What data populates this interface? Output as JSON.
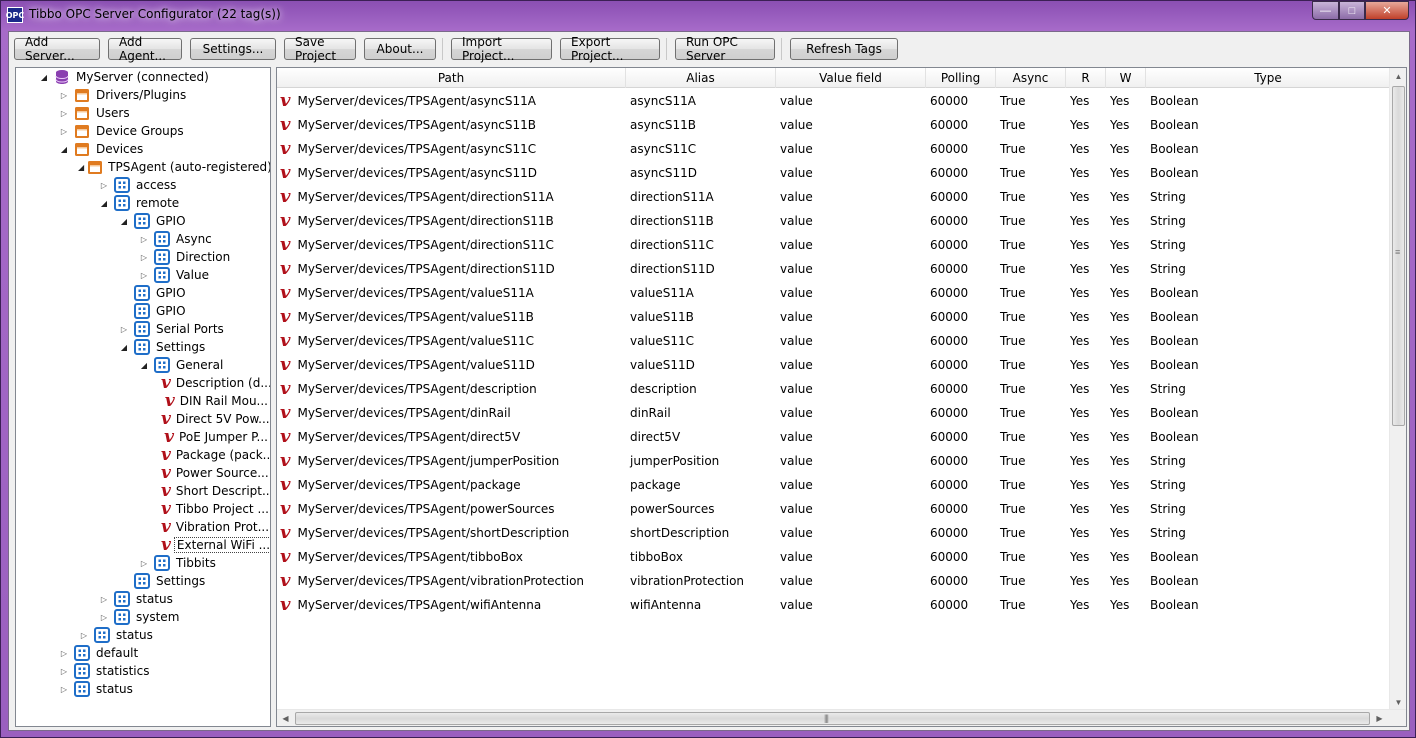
{
  "window": {
    "title": "Tibbo OPC Server Configurator (22 tag(s))",
    "icon_text": "OPC",
    "minimize_glyph": "—",
    "maximize_glyph": "□",
    "close_glyph": "✕"
  },
  "toolbar": {
    "buttons": [
      {
        "label": "Add Server..."
      },
      {
        "label": "Add Agent..."
      },
      {
        "label": "Settings..."
      },
      {
        "label": "Save Project"
      },
      {
        "label": "About..."
      },
      {
        "label": "Import Project..."
      },
      {
        "label": "Export Project..."
      },
      {
        "label": "Run OPC Server"
      },
      {
        "label": "Refresh Tags"
      }
    ]
  },
  "tree": {
    "items": [
      {
        "label": "MyServer (connected)",
        "level": 0,
        "icon": "database-icon",
        "expander": "open"
      },
      {
        "label": "Drivers/Plugins",
        "level": 1,
        "icon": "folder-icon",
        "expander": "closed"
      },
      {
        "label": "Users",
        "level": 1,
        "icon": "folder-icon",
        "expander": "closed"
      },
      {
        "label": "Device Groups",
        "level": 1,
        "icon": "folder-icon",
        "expander": "closed"
      },
      {
        "label": "Devices",
        "level": 1,
        "icon": "folder-icon",
        "expander": "open"
      },
      {
        "label": "TPSAgent (auto-registered)",
        "level": 2,
        "icon": "folder-icon",
        "expander": "open"
      },
      {
        "label": "access",
        "level": 3,
        "icon": "node-icon",
        "expander": "closed"
      },
      {
        "label": "remote",
        "level": 3,
        "icon": "node-icon",
        "expander": "open"
      },
      {
        "label": "GPIO",
        "level": 4,
        "icon": "node-icon",
        "expander": "open"
      },
      {
        "label": "Async",
        "level": 5,
        "icon": "node-icon",
        "expander": "closed"
      },
      {
        "label": "Direction",
        "level": 5,
        "icon": "node-icon",
        "expander": "closed"
      },
      {
        "label": "Value",
        "level": 5,
        "icon": "node-icon",
        "expander": "closed"
      },
      {
        "label": "GPIO",
        "level": 4,
        "icon": "node-icon",
        "expander": "none"
      },
      {
        "label": "GPIO",
        "level": 4,
        "icon": "node-icon",
        "expander": "none"
      },
      {
        "label": "Serial Ports",
        "level": 4,
        "icon": "node-icon",
        "expander": "closed"
      },
      {
        "label": "Settings",
        "level": 4,
        "icon": "node-icon",
        "expander": "open"
      },
      {
        "label": "General",
        "level": 5,
        "icon": "node-icon",
        "expander": "open"
      },
      {
        "label": "Description (d...",
        "level": 6,
        "icon": "variable-icon",
        "expander": "none"
      },
      {
        "label": "DIN Rail Mou...",
        "level": 6,
        "icon": "variable-icon",
        "expander": "none"
      },
      {
        "label": "Direct 5V Pow...",
        "level": 6,
        "icon": "variable-icon",
        "expander": "none"
      },
      {
        "label": "PoE Jumper P...",
        "level": 6,
        "icon": "variable-icon",
        "expander": "none"
      },
      {
        "label": "Package (pack...",
        "level": 6,
        "icon": "variable-icon",
        "expander": "none"
      },
      {
        "label": "Power Source...",
        "level": 6,
        "icon": "variable-icon",
        "expander": "none"
      },
      {
        "label": "Short Descript...",
        "level": 6,
        "icon": "variable-icon",
        "expander": "none"
      },
      {
        "label": "Tibbo Project ...",
        "level": 6,
        "icon": "variable-icon",
        "expander": "none"
      },
      {
        "label": "Vibration Prot...",
        "level": 6,
        "icon": "variable-icon",
        "expander": "none"
      },
      {
        "label": "External WiFi ...",
        "level": 6,
        "icon": "variable-icon",
        "expander": "none",
        "selected": true
      },
      {
        "label": "Tibbits",
        "level": 5,
        "icon": "node-icon",
        "expander": "closed"
      },
      {
        "label": "Settings",
        "level": 4,
        "icon": "node-icon",
        "expander": "none"
      },
      {
        "label": "status",
        "level": 3,
        "icon": "node-icon",
        "expander": "closed"
      },
      {
        "label": "system",
        "level": 3,
        "icon": "node-icon",
        "expander": "closed"
      },
      {
        "label": "status",
        "level": 2,
        "icon": "node-icon",
        "expander": "closed"
      },
      {
        "label": "default",
        "level": 1,
        "icon": "node-icon",
        "expander": "closed"
      },
      {
        "label": "statistics",
        "level": 1,
        "icon": "node-icon",
        "expander": "closed"
      },
      {
        "label": "status",
        "level": 1,
        "icon": "node-icon",
        "expander": "closed"
      }
    ]
  },
  "grid": {
    "columns": [
      "Path",
      "Alias",
      "Value field",
      "Polling",
      "Async",
      "R",
      "W",
      "Type"
    ],
    "rows": [
      [
        "MyServer/devices/TPSAgent/asyncS11A",
        "asyncS11A",
        "value",
        "60000",
        "True",
        "Yes",
        "Yes",
        "Boolean"
      ],
      [
        "MyServer/devices/TPSAgent/asyncS11B",
        "asyncS11B",
        "value",
        "60000",
        "True",
        "Yes",
        "Yes",
        "Boolean"
      ],
      [
        "MyServer/devices/TPSAgent/asyncS11C",
        "asyncS11C",
        "value",
        "60000",
        "True",
        "Yes",
        "Yes",
        "Boolean"
      ],
      [
        "MyServer/devices/TPSAgent/asyncS11D",
        "asyncS11D",
        "value",
        "60000",
        "True",
        "Yes",
        "Yes",
        "Boolean"
      ],
      [
        "MyServer/devices/TPSAgent/directionS11A",
        "directionS11A",
        "value",
        "60000",
        "True",
        "Yes",
        "Yes",
        "String"
      ],
      [
        "MyServer/devices/TPSAgent/directionS11B",
        "directionS11B",
        "value",
        "60000",
        "True",
        "Yes",
        "Yes",
        "String"
      ],
      [
        "MyServer/devices/TPSAgent/directionS11C",
        "directionS11C",
        "value",
        "60000",
        "True",
        "Yes",
        "Yes",
        "String"
      ],
      [
        "MyServer/devices/TPSAgent/directionS11D",
        "directionS11D",
        "value",
        "60000",
        "True",
        "Yes",
        "Yes",
        "String"
      ],
      [
        "MyServer/devices/TPSAgent/valueS11A",
        "valueS11A",
        "value",
        "60000",
        "True",
        "Yes",
        "Yes",
        "Boolean"
      ],
      [
        "MyServer/devices/TPSAgent/valueS11B",
        "valueS11B",
        "value",
        "60000",
        "True",
        "Yes",
        "Yes",
        "Boolean"
      ],
      [
        "MyServer/devices/TPSAgent/valueS11C",
        "valueS11C",
        "value",
        "60000",
        "True",
        "Yes",
        "Yes",
        "Boolean"
      ],
      [
        "MyServer/devices/TPSAgent/valueS11D",
        "valueS11D",
        "value",
        "60000",
        "True",
        "Yes",
        "Yes",
        "Boolean"
      ],
      [
        "MyServer/devices/TPSAgent/description",
        "description",
        "value",
        "60000",
        "True",
        "Yes",
        "Yes",
        "String"
      ],
      [
        "MyServer/devices/TPSAgent/dinRail",
        "dinRail",
        "value",
        "60000",
        "True",
        "Yes",
        "Yes",
        "Boolean"
      ],
      [
        "MyServer/devices/TPSAgent/direct5V",
        "direct5V",
        "value",
        "60000",
        "True",
        "Yes",
        "Yes",
        "Boolean"
      ],
      [
        "MyServer/devices/TPSAgent/jumperPosition",
        "jumperPosition",
        "value",
        "60000",
        "True",
        "Yes",
        "Yes",
        "String"
      ],
      [
        "MyServer/devices/TPSAgent/package",
        "package",
        "value",
        "60000",
        "True",
        "Yes",
        "Yes",
        "String"
      ],
      [
        "MyServer/devices/TPSAgent/powerSources",
        "powerSources",
        "value",
        "60000",
        "True",
        "Yes",
        "Yes",
        "String"
      ],
      [
        "MyServer/devices/TPSAgent/shortDescription",
        "shortDescription",
        "value",
        "60000",
        "True",
        "Yes",
        "Yes",
        "String"
      ],
      [
        "MyServer/devices/TPSAgent/tibboBox",
        "tibboBox",
        "value",
        "60000",
        "True",
        "Yes",
        "Yes",
        "Boolean"
      ],
      [
        "MyServer/devices/TPSAgent/vibrationProtection",
        "vibrationProtection",
        "value",
        "60000",
        "True",
        "Yes",
        "Yes",
        "Boolean"
      ],
      [
        "MyServer/devices/TPSAgent/wifiAntenna",
        "wifiAntenna",
        "value",
        "60000",
        "True",
        "Yes",
        "Yes",
        "Boolean"
      ]
    ]
  },
  "icons": {
    "variable_glyph": "v",
    "expander_open": "◢",
    "expander_closed": "▷",
    "scroll_up": "▲",
    "scroll_down": "▼",
    "scroll_left": "◀",
    "scroll_right": "▶",
    "grip_v": "≡",
    "grip_h": "|||"
  },
  "colors": {
    "variable_icon": "#b0101a",
    "folder_icon": "#e07b20",
    "node_icon": "#1f6ec8",
    "database_icon": "#8a3fb0"
  }
}
